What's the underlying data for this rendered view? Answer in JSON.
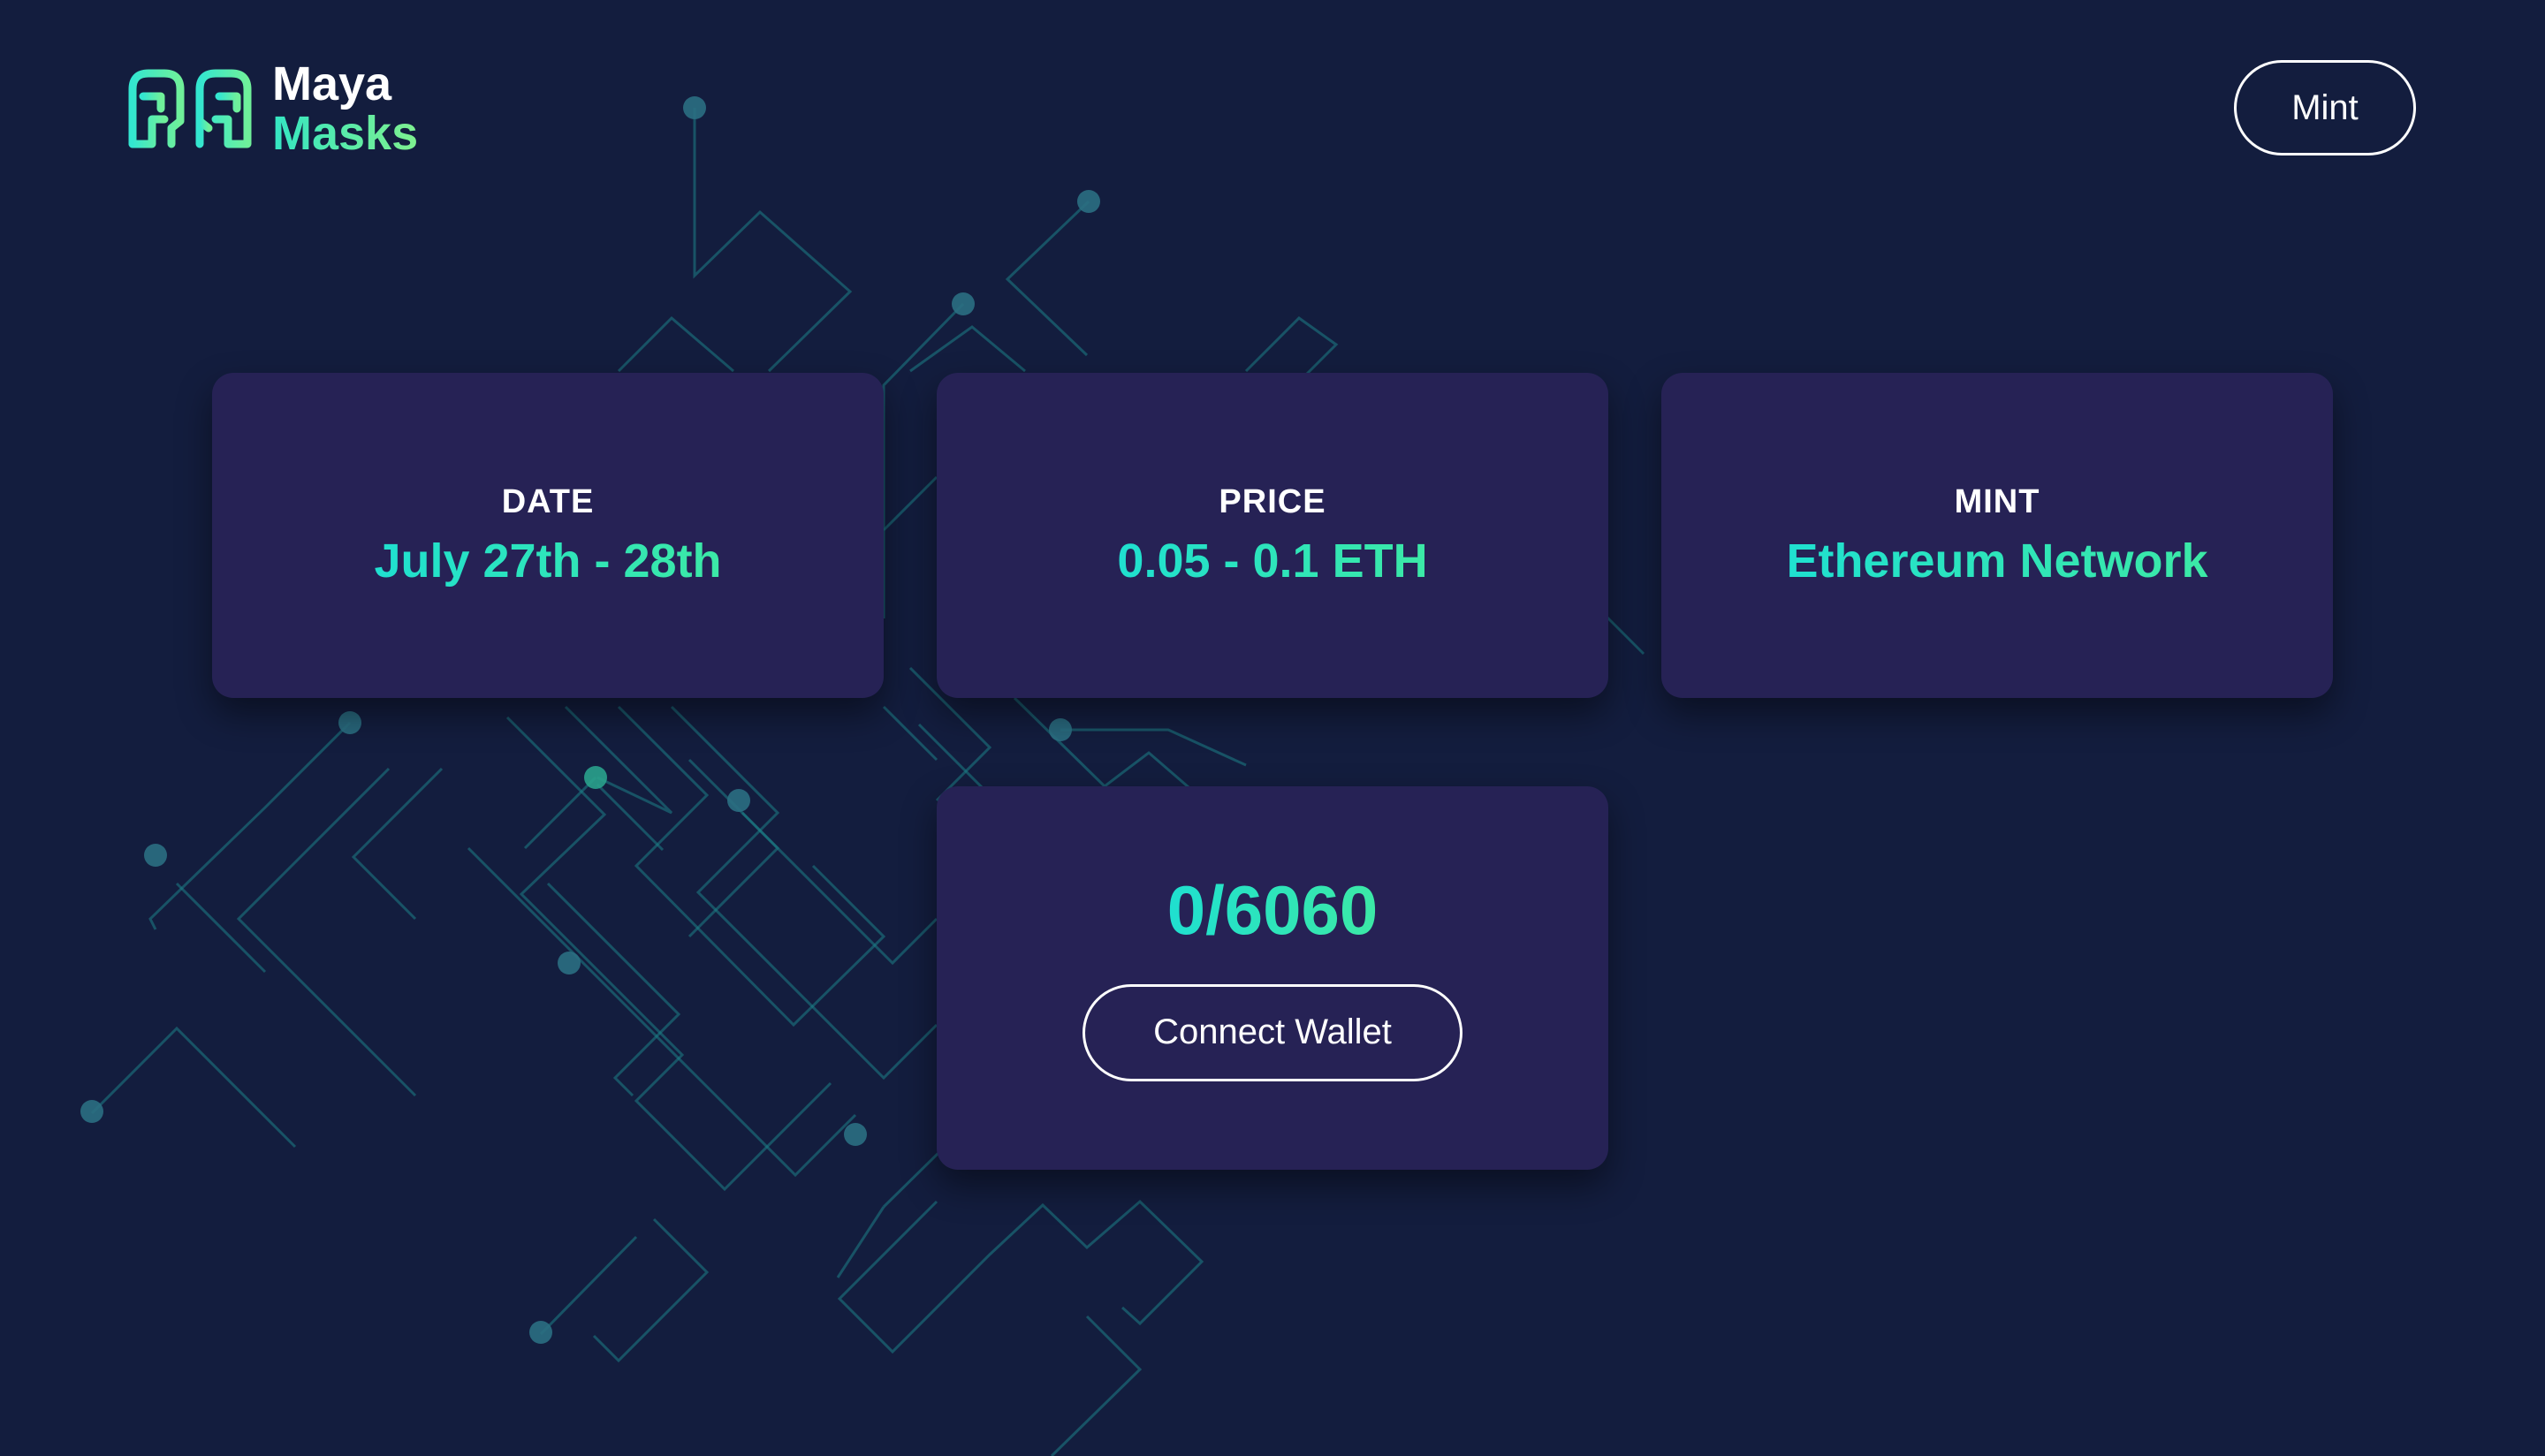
{
  "brand": {
    "line1": "Maya",
    "line2": "Masks"
  },
  "nav": {
    "mint_label": "Mint"
  },
  "cards": {
    "date": {
      "label": "DATE",
      "value": "July 27th - 28th"
    },
    "price": {
      "label": "PRICE",
      "value": "0.05 - 0.1 ETH"
    },
    "mint": {
      "label": "MINT",
      "value": "Ethereum Network"
    }
  },
  "counter": {
    "value": "0/6060",
    "connect_label": "Connect Wallet"
  },
  "colors": {
    "background": "#131d3e",
    "card": "#262255",
    "accent": "#22e3c4",
    "accent_secondary": "#3ce9a6",
    "text": "#ffffff"
  },
  "icons": {
    "logo": "maya-mask-logo-icon"
  }
}
